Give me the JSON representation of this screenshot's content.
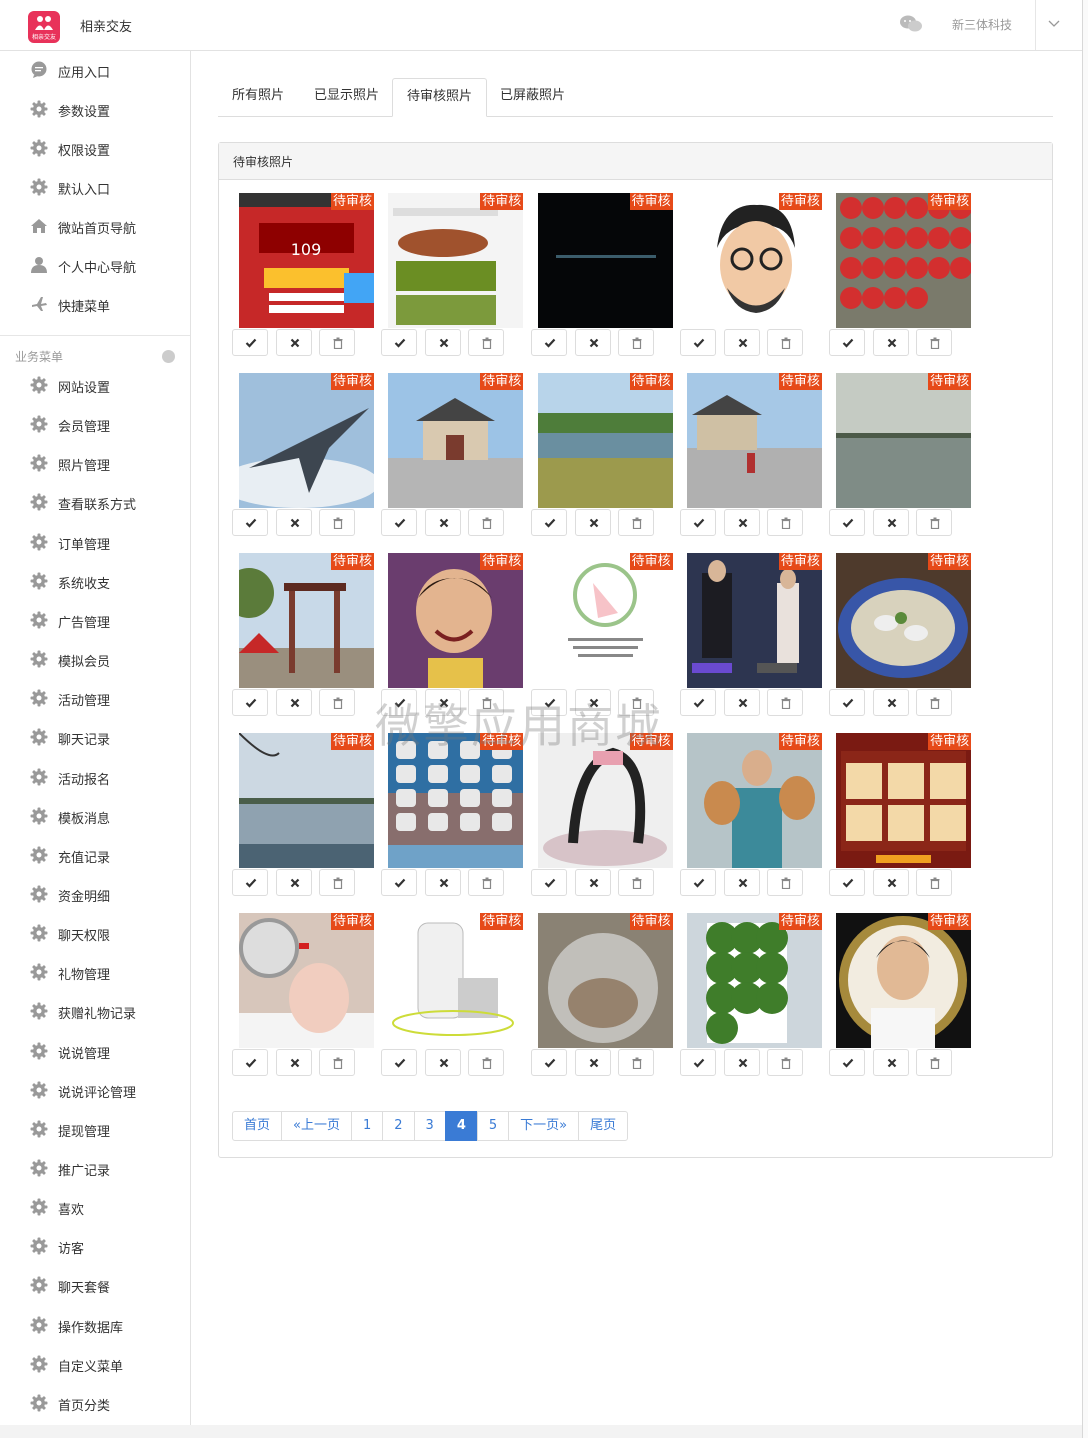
{
  "header": {
    "app_name": "相亲交友",
    "logo_text": "相亲交友",
    "company": "新三体科技"
  },
  "sidebar": {
    "top_items": [
      {
        "label": "应用入口",
        "icon": "chat-icon"
      },
      {
        "label": "参数设置",
        "icon": "gear-icon"
      },
      {
        "label": "权限设置",
        "icon": "gear-icon"
      },
      {
        "label": "默认入口",
        "icon": "gear-icon"
      },
      {
        "label": "微站首页导航",
        "icon": "home-icon"
      },
      {
        "label": "个人中心导航",
        "icon": "user-icon"
      },
      {
        "label": "快捷菜单",
        "icon": "plane-icon"
      }
    ],
    "section_label": "业务菜单",
    "business_items": [
      "网站设置",
      "会员管理",
      "照片管理",
      "查看联系方式",
      "订单管理",
      "系统收支",
      "广告管理",
      "模拟会员",
      "活动管理",
      "聊天记录",
      "活动报名",
      "模板消息",
      "充值记录",
      "资金明细",
      "聊天权限",
      "礼物管理",
      "获赠礼物记录",
      "说说管理",
      "说说评论管理",
      "提现管理",
      "推广记录",
      "喜欢",
      "访客",
      "聊天套餐",
      "操作数据库",
      "自定义菜单",
      "首页分类"
    ]
  },
  "tabs": [
    "所有照片",
    "已显示照片",
    "待审核照片",
    "已屏蔽照片"
  ],
  "active_tab": "待审核照片",
  "panel_title": "待审核照片",
  "badge_label": "待审核",
  "photos": [
    {
      "subject": "game-screenshot"
    },
    {
      "subject": "honey-and-fields"
    },
    {
      "subject": "dark-text-screen"
    },
    {
      "subject": "cartoon-avatar"
    },
    {
      "subject": "tomatoes"
    },
    {
      "subject": "fighter-jet"
    },
    {
      "subject": "palace-gate"
    },
    {
      "subject": "riverside-park"
    },
    {
      "subject": "palace-square"
    },
    {
      "subject": "lake"
    },
    {
      "subject": "park-gate"
    },
    {
      "subject": "smiling-child"
    },
    {
      "subject": "illustrated-card"
    },
    {
      "subject": "couple-movie-poster"
    },
    {
      "subject": "dumpling-soup"
    },
    {
      "subject": "lake-shore"
    },
    {
      "subject": "phone-home-screen"
    },
    {
      "subject": "yoga-pose"
    },
    {
      "subject": "man-with-dogs"
    },
    {
      "subject": "game-score-screen"
    },
    {
      "subject": "pig-costume"
    },
    {
      "subject": "white-appliance"
    },
    {
      "subject": "plastic-bag"
    },
    {
      "subject": "plant-wall"
    },
    {
      "subject": "man-portrait"
    }
  ],
  "photo_actions": [
    "approve-icon",
    "reject-icon",
    "trash-icon"
  ],
  "pagination": {
    "items": [
      {
        "label": "首页"
      },
      {
        "label": "«上一页"
      },
      {
        "label": "1"
      },
      {
        "label": "2"
      },
      {
        "label": "3"
      },
      {
        "label": "4",
        "active": true
      },
      {
        "label": "5"
      },
      {
        "label": "下一页»"
      },
      {
        "label": "尾页"
      }
    ]
  },
  "watermark": "微擎应用商城",
  "colors": {
    "badge": "#e64a19",
    "accent": "#3a7bd5",
    "logo": "#e8325a"
  }
}
